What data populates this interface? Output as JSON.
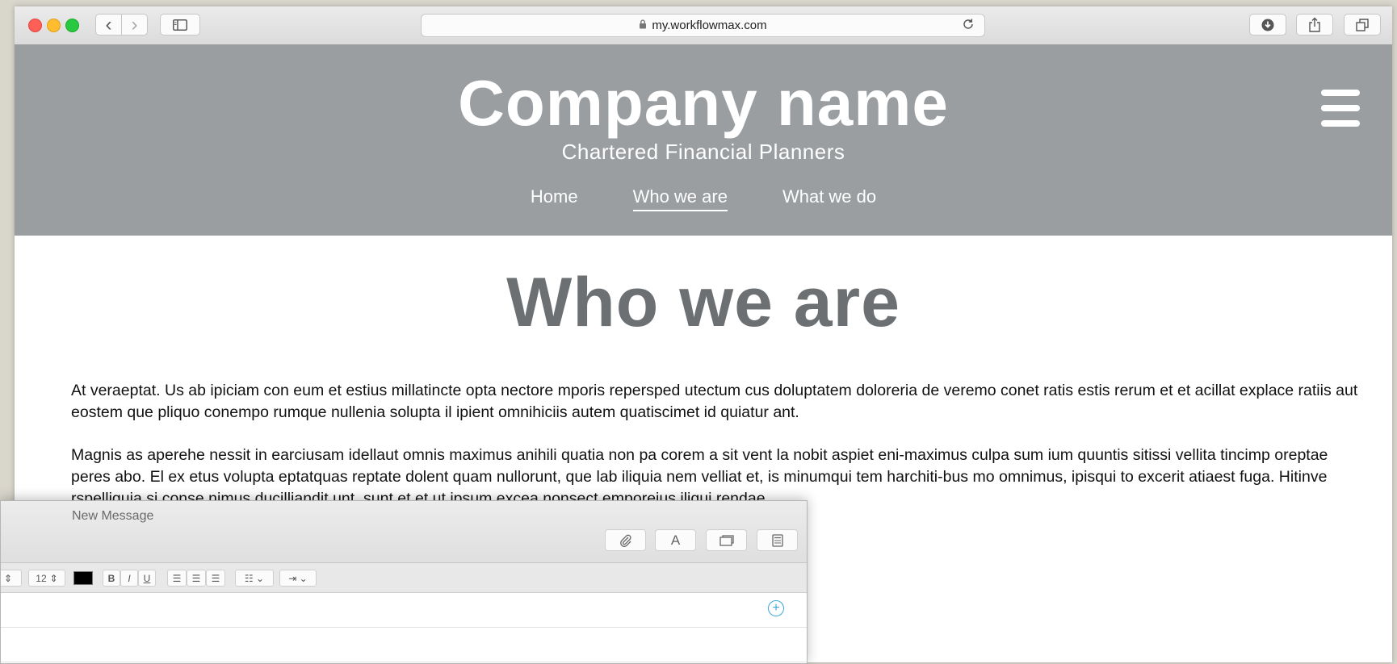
{
  "browser": {
    "url": "my.workflowmax.com",
    "back_icon": "‹",
    "forward_icon": "›"
  },
  "site": {
    "company_name": "Company name",
    "tagline": "Chartered Financial Planners",
    "nav": [
      {
        "label": "Home",
        "active": false
      },
      {
        "label": "Who we are",
        "active": true
      },
      {
        "label": "What we do",
        "active": false
      }
    ]
  },
  "main": {
    "title": "Who we are",
    "paragraph1": "At veraeptat. Us ab ipiciam con eum et estius millatincte opta nectore mporis repersped utectum cus doluptatem doloreria de veremo conet ratis estis rerum et et acillat explace ratiis aut eostem que pliquo conempo rumque nullenia solupta il ipient omnihiciis autem quatiscimet id quiatur ant.",
    "paragraph2": "Magnis as aperehe nessit in earciusam idellaut omnis maximus anihili quatia non pa corem a sit vent la nobit aspiet eni-maximus culpa sum ium quuntis sitissi vellita tincimp oreptae peres abo. El ex etus volupta eptatquas reptate dolent quam nullorunt, que lab iliquia nem velliat et, is minumqui tem harchiti-bus mo omnimus, ipisqui to excerit atiaest fuga. Hitinve rspelliquia si conse nimus ducilliandit unt, sunt et et ut ipsum excea nonsect emporeius iliqui rendae"
  },
  "compose": {
    "title": "New Message",
    "font_size": "12",
    "tool_icons": [
      "paperclip-icon",
      "font-icon",
      "window-icon",
      "calculator-icon"
    ],
    "font_button_label": "A",
    "text_color": "#000000"
  },
  "colors": {
    "header_bg": "#9a9ea1",
    "title_color": "#6d7072",
    "accent": "#3aa7d9"
  }
}
